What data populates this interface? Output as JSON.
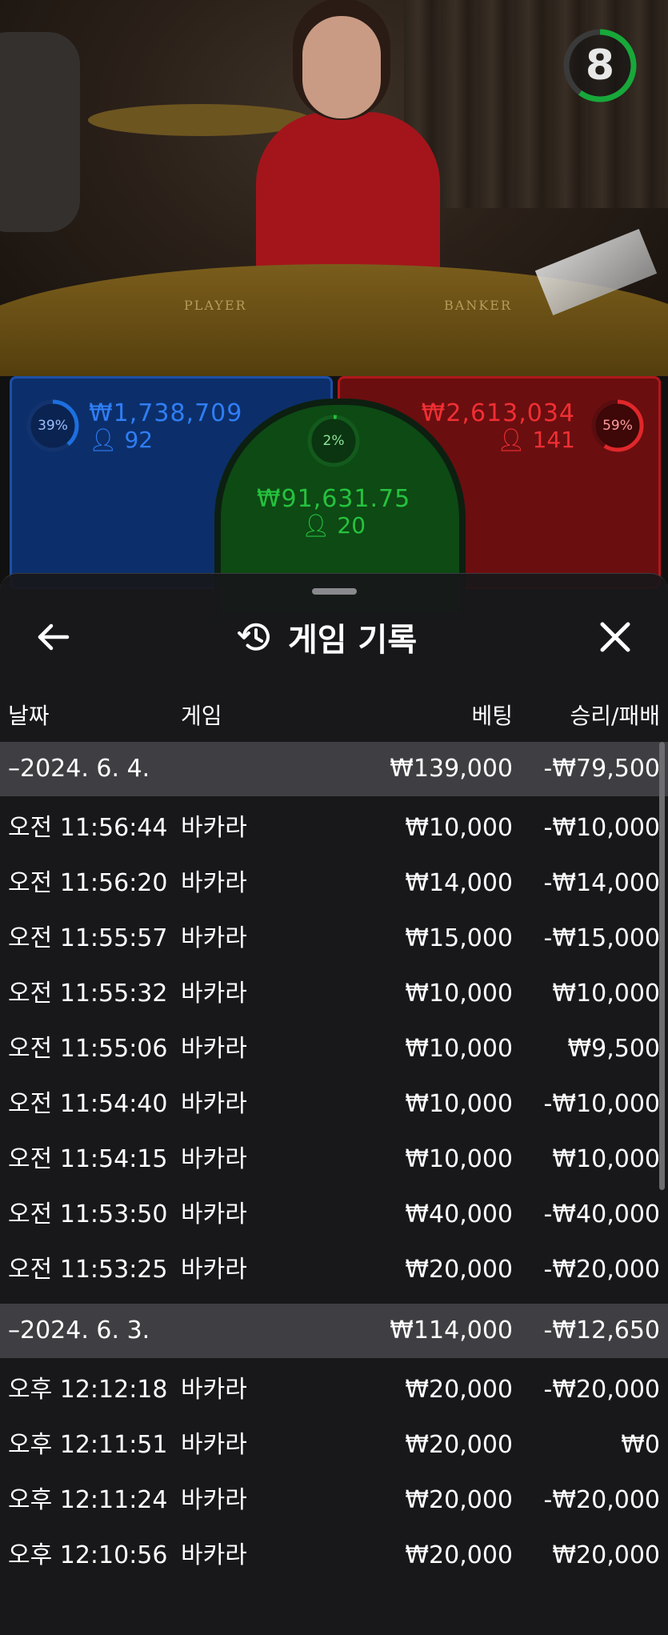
{
  "video": {
    "table_left_text": "PLAYER",
    "table_right_text": "BANKER",
    "timer": "8",
    "timer_fraction": 0.6,
    "timer_color": "#17a83a"
  },
  "bets": {
    "player": {
      "amount": "₩1,738,709",
      "count": "92",
      "percent": "39%",
      "percent_value": 0.39,
      "color": "#1d6fe0"
    },
    "tie": {
      "amount": "₩91,631.75",
      "count": "20",
      "percent": "2%",
      "percent_value": 0.02,
      "color": "#22c13c"
    },
    "banker": {
      "amount": "₩2,613,034",
      "count": "141",
      "percent": "59%",
      "percent_value": 0.59,
      "color": "#e0272a"
    }
  },
  "history": {
    "title": "게임 기록",
    "columns": {
      "date": "날짜",
      "game": "게임",
      "bet": "베팅",
      "win": "승리/패배"
    },
    "groups": [
      {
        "date": "–2024. 6. 4.",
        "bet": "₩139,000",
        "win": "-₩79,500",
        "rows": [
          {
            "time": "오전 11:56:44",
            "game": "바카라",
            "bet": "₩10,000",
            "win": "-₩10,000"
          },
          {
            "time": "오전 11:56:20",
            "game": "바카라",
            "bet": "₩14,000",
            "win": "-₩14,000"
          },
          {
            "time": "오전 11:55:57",
            "game": "바카라",
            "bet": "₩15,000",
            "win": "-₩15,000"
          },
          {
            "time": "오전 11:55:32",
            "game": "바카라",
            "bet": "₩10,000",
            "win": "₩10,000"
          },
          {
            "time": "오전 11:55:06",
            "game": "바카라",
            "bet": "₩10,000",
            "win": "₩9,500"
          },
          {
            "time": "오전 11:54:40",
            "game": "바카라",
            "bet": "₩10,000",
            "win": "-₩10,000"
          },
          {
            "time": "오전 11:54:15",
            "game": "바카라",
            "bet": "₩10,000",
            "win": "₩10,000"
          },
          {
            "time": "오전 11:53:50",
            "game": "바카라",
            "bet": "₩40,000",
            "win": "-₩40,000"
          },
          {
            "time": "오전 11:53:25",
            "game": "바카라",
            "bet": "₩20,000",
            "win": "-₩20,000"
          }
        ]
      },
      {
        "date": "–2024. 6. 3.",
        "bet": "₩114,000",
        "win": "-₩12,650",
        "rows": [
          {
            "time": "오후 12:12:18",
            "game": "바카라",
            "bet": "₩20,000",
            "win": "-₩20,000"
          },
          {
            "time": "오후 12:11:51",
            "game": "바카라",
            "bet": "₩20,000",
            "win": "₩0"
          },
          {
            "time": "오후 12:11:24",
            "game": "바카라",
            "bet": "₩20,000",
            "win": "-₩20,000"
          },
          {
            "time": "오후 12:10:56",
            "game": "바카라",
            "bet": "₩20,000",
            "win": "₩20,000"
          }
        ]
      }
    ]
  },
  "icons": {
    "back": "arrow-left-icon",
    "history": "history-icon",
    "close": "close-icon",
    "user": "user-icon"
  }
}
